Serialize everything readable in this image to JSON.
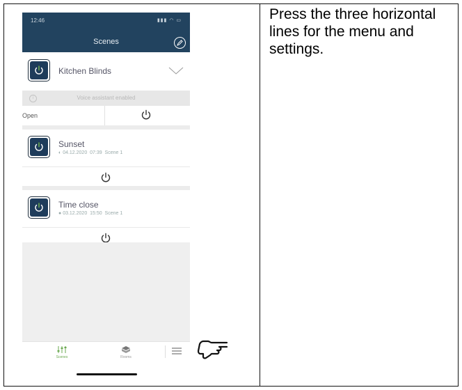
{
  "instruction": "Press the three horizontal lines for the menu and settings.",
  "status_bar": {
    "time": "12:46",
    "icons": "▮▮▮ ◠ ▭"
  },
  "header": {
    "title": "Scenes"
  },
  "scenes": [
    {
      "name": "Kitchen Blinds",
      "expanded": true,
      "voice_text": "Voice assistant enabled",
      "action_label": "Open"
    },
    {
      "name": "Sunset",
      "date": "04.12.2020",
      "time": "07:39",
      "scene": "Scene 1"
    },
    {
      "name": "Time close",
      "date": "03.12.2020",
      "time": "15:50",
      "scene": "Scene 1"
    }
  ],
  "tabs": [
    {
      "label": "Scenes",
      "active": true,
      "icon": "sliders-icon"
    },
    {
      "label": "Rooms",
      "active": false,
      "icon": "rooms-cube-icon"
    }
  ],
  "colors": {
    "header": "#22435f",
    "accent_green": "#6aa84f",
    "icon_dark": "#1e3c5b"
  }
}
